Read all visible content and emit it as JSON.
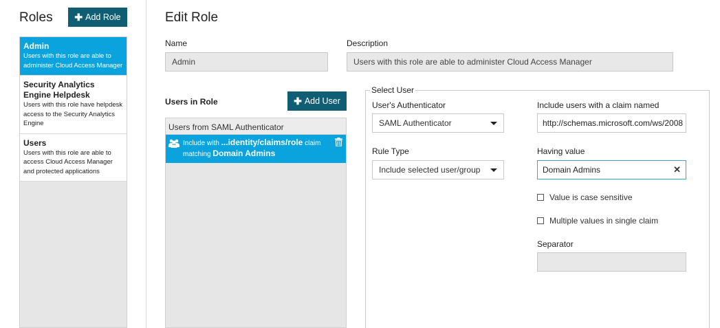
{
  "sidebar": {
    "title": "Roles",
    "add_role_label": "Add Role",
    "roles": [
      {
        "name": "Admin",
        "description": "Users with this role are able to administer Cloud Access Manager",
        "selected": true
      },
      {
        "name": "Security Analytics Engine Helpdesk",
        "description": "Users with this role have helpdesk access to the Security Analytics Engine",
        "selected": false
      },
      {
        "name": "Users",
        "description": "Users with this role are able to access Cloud Access Manager and protected applications",
        "selected": false
      }
    ]
  },
  "main": {
    "title": "Edit Role",
    "name_label": "Name",
    "name_value": "Admin",
    "description_label": "Description",
    "description_value": "Users with this role are able to administer Cloud Access Manager",
    "users_in_role_label": "Users in Role",
    "add_user_label": "Add User",
    "users_panel": {
      "header": "Users from SAML Authenticator",
      "entry": {
        "prefix": "Include with",
        "claim": "...identity/claims/role",
        "mid": "claim",
        "matching": "matching",
        "value": "Domain Admins"
      }
    },
    "select_user": {
      "legend": "Select User",
      "authenticator_label": "User's Authenticator",
      "authenticator_value": "SAML Authenticator",
      "rule_type_label": "Rule Type",
      "rule_type_value": "Include selected user/group",
      "claim_label": "Include users with a claim named",
      "claim_value": "http://schemas.microsoft.com/ws/2008",
      "having_value_label": "Having value",
      "having_value_value": "Domain Admins",
      "case_sensitive_label": "Value is case sensitive",
      "multiple_values_label": "Multiple values in single claim",
      "separator_label": "Separator",
      "separator_value": ""
    }
  },
  "colors": {
    "accent": "#0aa3dd",
    "button": "#0f5e73",
    "focus_border": "#35a4d4"
  },
  "icons": [
    "plus-icon",
    "users-icon",
    "trash-icon",
    "chevron-down-icon",
    "clear-icon",
    "checkbox"
  ]
}
